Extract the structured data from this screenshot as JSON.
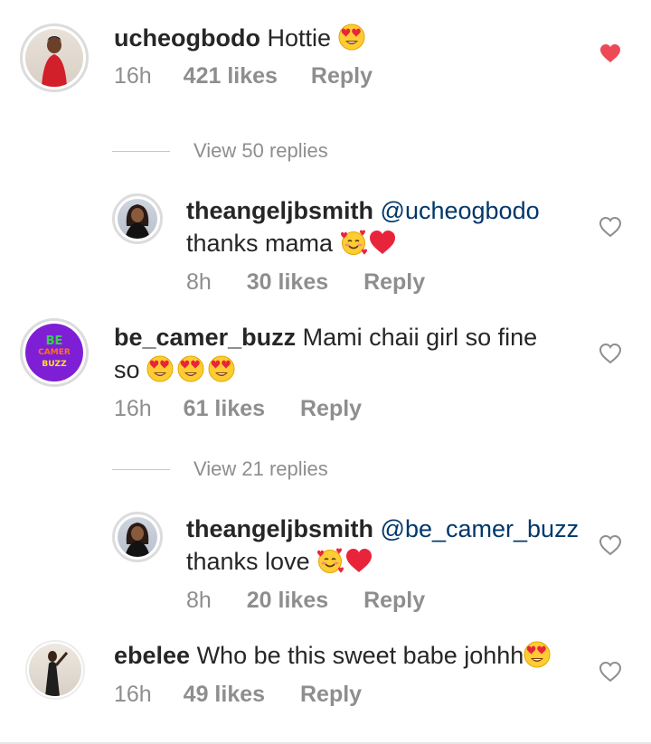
{
  "comments": [
    {
      "username": "ucheogbodo",
      "text": "Hottie",
      "emoji": [
        "heart-eyes"
      ],
      "time": "16h",
      "likes": "421 likes",
      "reply": "Reply",
      "liked": true,
      "view_replies": "View 50 replies",
      "replies": [
        {
          "username": "theangeljbsmith",
          "mention": "@ucheogbodo",
          "text": "thanks mama",
          "emoji": [
            "smiling-hearts",
            "red-heart"
          ],
          "time": "8h",
          "likes": "30 likes",
          "reply": "Reply",
          "liked": false
        }
      ]
    },
    {
      "username": "be_camer_buzz",
      "text": "Mami chaii girl so fine",
      "text_line2": "so",
      "emoji": [
        "heart-eyes",
        "heart-eyes",
        "heart-eyes"
      ],
      "avatar_text": [
        "BE",
        "CAMER",
        "BUZZ"
      ],
      "time": "16h",
      "likes": "61 likes",
      "reply": "Reply",
      "liked": false,
      "view_replies": "View 21 replies",
      "replies": [
        {
          "username": "theangeljbsmith",
          "mention": "@be_camer_buzz",
          "text": "thanks love",
          "emoji": [
            "smiling-hearts",
            "red-heart"
          ],
          "time": "8h",
          "likes": "20 likes",
          "reply": "Reply",
          "liked": false
        }
      ]
    },
    {
      "username": "ebelee",
      "text": "Who be this sweet babe johhh",
      "emoji": [
        "heart-eyes"
      ],
      "time": "16h",
      "likes": "49 likes",
      "reply": "Reply",
      "liked": false
    }
  ],
  "colors": {
    "liked_heart": "#ed4956",
    "mention": "#00376b",
    "muted": "#8e8e8e"
  }
}
